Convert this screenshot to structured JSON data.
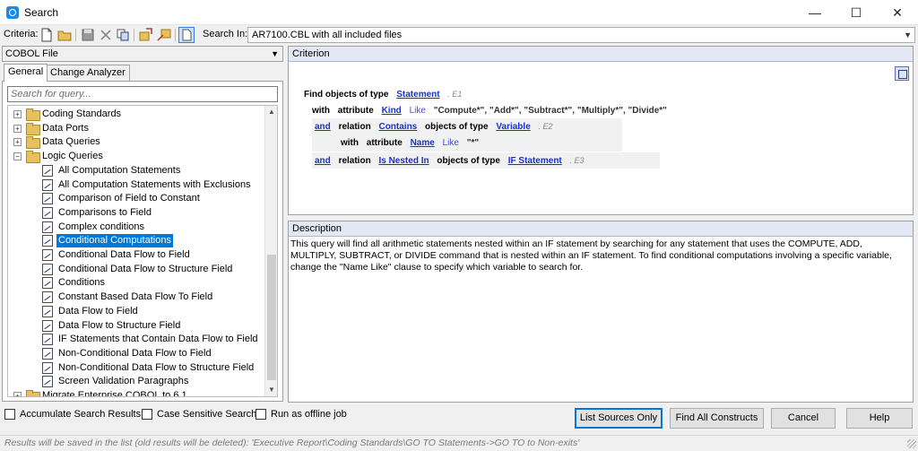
{
  "window": {
    "title": "Search",
    "minimize": "—",
    "maximize": "☐",
    "close": "✕"
  },
  "toolbar": {
    "criteria_label": "Criteria:",
    "search_in_label": "Search In:",
    "search_in_value": "AR7100.CBL with all included files",
    "icons": [
      "new-icon",
      "open-icon",
      "save-icon",
      "delete-icon",
      "copy-icon",
      "import-icon",
      "export-icon",
      "preview-icon"
    ]
  },
  "left_panel": {
    "scope_value": "COBOL File",
    "tabs": [
      "General",
      "Change Analyzer"
    ],
    "search_placeholder": "Search for query...",
    "tree": [
      {
        "label": "Coding Standards",
        "type": "folder",
        "expander": "+"
      },
      {
        "label": "Data Ports",
        "type": "folder",
        "expander": "+"
      },
      {
        "label": "Data Queries",
        "type": "folder",
        "expander": "+"
      },
      {
        "label": "Logic Queries",
        "type": "folder",
        "expander": "−"
      },
      {
        "label": "All Computation Statements",
        "type": "query"
      },
      {
        "label": "All Computation Statements with Exclusions",
        "type": "query"
      },
      {
        "label": "Comparison of Field to Constant",
        "type": "query"
      },
      {
        "label": "Comparisons to Field",
        "type": "query"
      },
      {
        "label": "Complex conditions",
        "type": "query"
      },
      {
        "label": "Conditional Computations",
        "type": "query",
        "selected": true
      },
      {
        "label": "Conditional Data Flow to Field",
        "type": "query"
      },
      {
        "label": "Conditional Data Flow to Structure Field",
        "type": "query"
      },
      {
        "label": "Conditions",
        "type": "query"
      },
      {
        "label": "Constant Based Data Flow To Field",
        "type": "query"
      },
      {
        "label": "Data Flow to Field",
        "type": "query"
      },
      {
        "label": "Data Flow to Structure Field",
        "type": "query"
      },
      {
        "label": "IF Statements that Contain Data Flow to Field",
        "type": "query"
      },
      {
        "label": "Non-Conditional Data Flow to Field",
        "type": "query"
      },
      {
        "label": "Non-Conditional Data Flow to Structure Field",
        "type": "query"
      },
      {
        "label": "Screen Validation Paragraphs",
        "type": "query"
      },
      {
        "label": "Migrate Enterprise COBOL to 6.1",
        "type": "folder",
        "expander": "+"
      }
    ]
  },
  "criterion": {
    "header": "Criterion",
    "line1": {
      "find": "Find objects of type",
      "type_link": "Statement",
      "ref": ". E1"
    },
    "line2": {
      "with": "with",
      "attribute": "attribute",
      "attr_link": "Kind",
      "like": "Like",
      "values": "\"Compute*\",  \"Add*\",  \"Subtract*\",  \"Multiply*\",  \"Divide*\""
    },
    "line3": {
      "and": "and",
      "relation": "relation",
      "rel_link": "Contains",
      "objects": "objects of type",
      "type_link": "Variable",
      "ref": ". E2"
    },
    "line4": {
      "with": "with",
      "attribute": "attribute",
      "attr_link": "Name",
      "like": "Like",
      "values": "\"*\""
    },
    "line5": {
      "and": "and",
      "relation": "relation",
      "rel_link": "Is Nested In",
      "objects": "objects of type",
      "type_link": "IF Statement",
      "ref": ". E3"
    }
  },
  "description": {
    "header": "Description",
    "text": "This query will find all arithmetic statements nested within an IF statement by searching for any statement that uses the COMPUTE, ADD, MULTIPLY, SUBTRACT, or DIVIDE command that is nested within an IF statement.  To find conditional computations involving a specific variable, change the \"Name Like\" clause to specify which variable to search for."
  },
  "options": {
    "accumulate": "Accumulate Search Results",
    "case_sensitive": "Case Sensitive Search",
    "offline": "Run as offline job"
  },
  "buttons": {
    "list_sources": "List Sources Only",
    "find_all": "Find All Constructs",
    "cancel": "Cancel",
    "help": "Help"
  },
  "status": "Results will be saved in the list (old results will be deleted): 'Executive Report\\Coding Standards\\GO TO Statements->GO TO to Non-exits'"
}
